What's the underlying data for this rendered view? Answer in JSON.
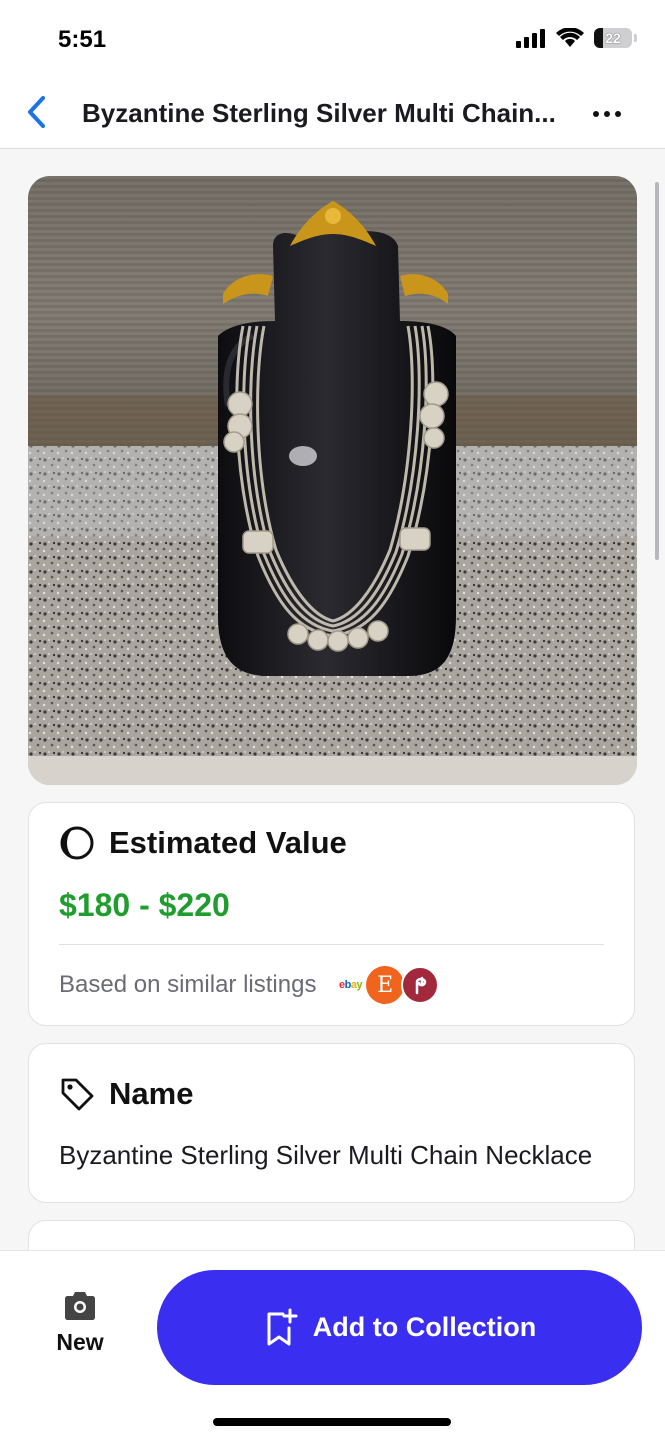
{
  "status_bar": {
    "time": "5:51",
    "battery": "22"
  },
  "nav": {
    "title": "Byzantine Sterling Silver Multi Chain...",
    "back_icon": "chevron-left-icon",
    "more_icon": "ellipsis-icon"
  },
  "photo": {
    "description_icon": "product-photo"
  },
  "value_card": {
    "title": "Estimated Value",
    "range": "$180 - $220",
    "based_on": "Based on similar listings",
    "sources_icons": [
      "ebay-logo",
      "etsy-logo",
      "poshmark-logo"
    ],
    "source_etsy_letter": "E",
    "source_ebay_text": "ebay"
  },
  "name_card": {
    "title": "Name",
    "value": "Byzantine Sterling Silver Multi Chain Necklace"
  },
  "bottom": {
    "new_label": "New",
    "add_label": "Add to Collection"
  },
  "colors": {
    "accent": "#3a2ff0",
    "value_green": "#1f9d2e",
    "link_blue": "#1a73e8"
  }
}
